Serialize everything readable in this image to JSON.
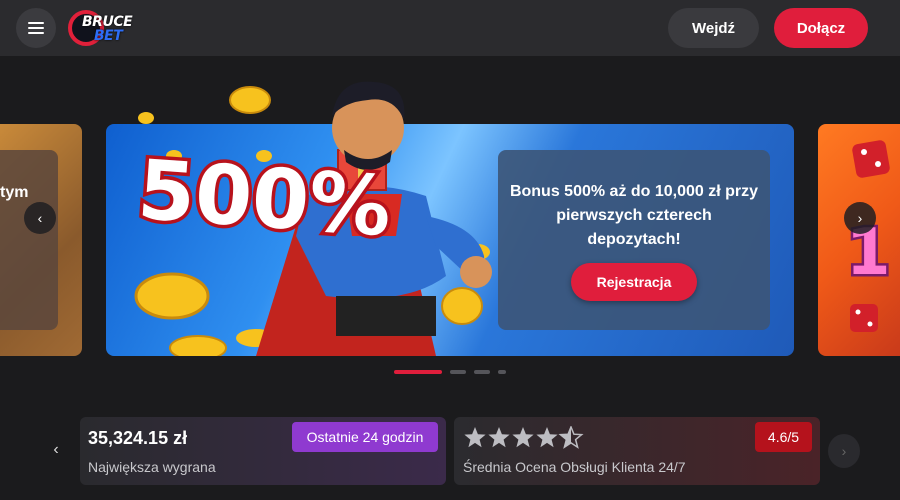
{
  "header": {
    "logo_top": "BRUCE",
    "logo_bottom": "BET",
    "login_label": "Wejdź",
    "join_label": "Dołącz"
  },
  "carousel": {
    "prev_slide_text": "tym",
    "bonus_text": "Bonus 500% aż do 10,000 zł przy pierwszych czterech depozytach!",
    "register_label": "Rejestracja",
    "hero_percent": "500%",
    "next_slide_text": "1",
    "active_dot": 0,
    "dot_count": 4
  },
  "stats": {
    "biggest_win_amount": "35,324.15 zł",
    "biggest_win_label": "Największa wygrana",
    "period_badge": "Ostatnie 24 godzin",
    "rating_stars": 4.5,
    "rating_value": "4.6/5",
    "rating_label": "Średnia Ocena Obsługi Klienta 24/7"
  },
  "colors": {
    "accent": "#e01e3c",
    "badge_purple": "#8f3ad0",
    "rating_red": "#b5121c"
  }
}
